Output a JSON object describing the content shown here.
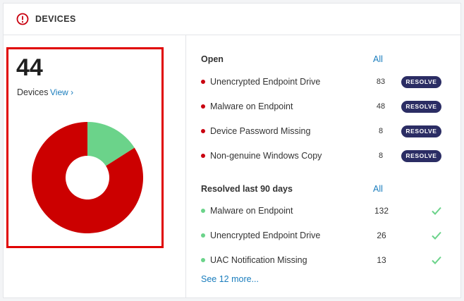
{
  "header": {
    "title": "DEVICES",
    "icon": "alert-circle-icon",
    "icon_color": "#c9000f"
  },
  "summary": {
    "count": "44",
    "label": "Devices",
    "view_link": "View ›",
    "donut": {
      "open_fraction": 0.84,
      "resolved_fraction": 0.16,
      "open_color": "#cc0000",
      "resolved_color": "#6bd38a"
    }
  },
  "open": {
    "title": "Open",
    "all_link": "All",
    "items": [
      {
        "label": "Unencrypted Endpoint Drive",
        "count": "83",
        "action": "RESOLVE"
      },
      {
        "label": "Malware on Endpoint",
        "count": "48",
        "action": "RESOLVE"
      },
      {
        "label": "Device Password Missing",
        "count": "8",
        "action": "RESOLVE"
      },
      {
        "label": "Non-genuine Windows Copy",
        "count": "8",
        "action": "RESOLVE"
      }
    ]
  },
  "resolved": {
    "title": "Resolved last 90 days",
    "all_link": "All",
    "items": [
      {
        "label": "Malware on Endpoint",
        "count": "132"
      },
      {
        "label": "Unencrypted Endpoint Drive",
        "count": "26"
      },
      {
        "label": "UAC Notification Missing",
        "count": "13"
      }
    ],
    "more_link": "See 12 more..."
  },
  "colors": {
    "accent": "#1a7dbd",
    "button": "#2b2d64",
    "check": "#6bd38a",
    "highlight": "#e00000"
  }
}
